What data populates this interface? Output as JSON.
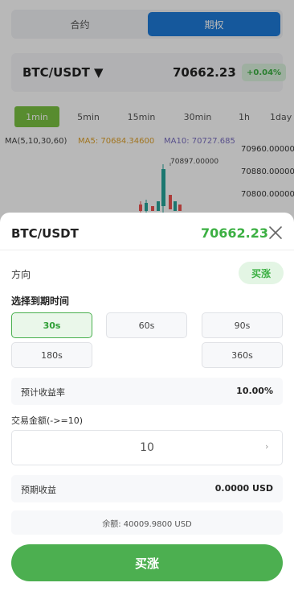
{
  "background": {
    "tabs": {
      "contract": "合约",
      "option": "期权"
    },
    "pair": {
      "name": "BTC/USDT ▼",
      "price": "70662.23",
      "change": "+0.04%"
    },
    "intervals": [
      "1min",
      "5min",
      "15min",
      "30min",
      "1h",
      "1day"
    ],
    "ma": {
      "main": "MA(5,10,30,60)",
      "ma5": "MA5: 70684.34600",
      "ma10": "MA10: 70727.6850"
    },
    "axis_labels": [
      "70960.00000",
      "70880.00000",
      "70800.00000"
    ],
    "peak_label": "70897.00000",
    "colors": {
      "up": "#26a69a",
      "down": "#ef5350",
      "ma5": "#e0a22c",
      "ma10": "#7b6fc2",
      "active_tab": "#1e7bd8",
      "active_interval": "#7bc242"
    }
  },
  "sheet": {
    "title": "BTC/USDT",
    "price": "70662.23",
    "close_icon": "close-icon",
    "direction": {
      "label": "方向",
      "value": "买涨"
    },
    "expiry": {
      "label": "选择到期时间",
      "options": [
        "30s",
        "60s",
        "90s",
        "180s",
        "360s"
      ],
      "selected": "30s"
    },
    "yield": {
      "label": "预计收益率",
      "value": "10.00%"
    },
    "amount": {
      "label": "交易金额(->=10)",
      "value": "10"
    },
    "profit": {
      "label": "预期收益",
      "value": "0.0000 USD"
    },
    "balance": "余额: 40009.9800 USD",
    "submit": "买涨",
    "colors": {
      "accent": "#4caf50",
      "price": "#3cb043"
    }
  }
}
